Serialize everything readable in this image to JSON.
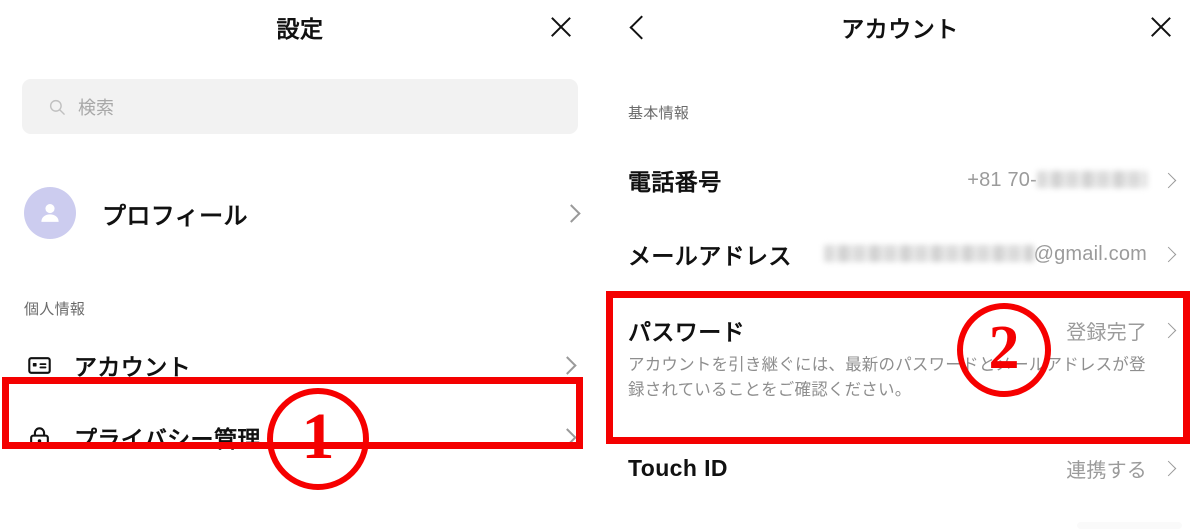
{
  "settings_panel": {
    "title": "設定",
    "close_icon": "close-icon",
    "search": {
      "placeholder": "検索",
      "icon": "search-icon"
    },
    "profile": {
      "label": "プロフィール",
      "icon": "person-avatar-icon",
      "avatar_color": "#ccccef"
    },
    "section_personal": "個人情報",
    "items": [
      {
        "label": "アカウント",
        "icon": "id-card-icon"
      },
      {
        "label": "プライバシー管理",
        "icon": "lock-icon"
      }
    ]
  },
  "account_panel": {
    "title": "アカウント",
    "back_icon": "back-chevron-icon",
    "close_icon": "close-icon",
    "section_basic": "基本情報",
    "phone": {
      "label": "電話番号",
      "value_prefix": "+81 70-",
      "value_redacted": true
    },
    "email": {
      "label": "メールアドレス",
      "value_suffix": "@gmail.com",
      "value_redacted": true
    },
    "password": {
      "label": "パスワード",
      "status": "登録完了",
      "description": "アカウントを引き継ぐには、最新のパスワードとメールアドレスが登録されていることをご確認ください。"
    },
    "touch_id": {
      "label": "Touch ID",
      "status": "連携する"
    }
  },
  "annotations": {
    "color": "#f40000",
    "steps": [
      {
        "number": "1",
        "target": "アカウント"
      },
      {
        "number": "2",
        "target": "パスワード"
      }
    ]
  }
}
